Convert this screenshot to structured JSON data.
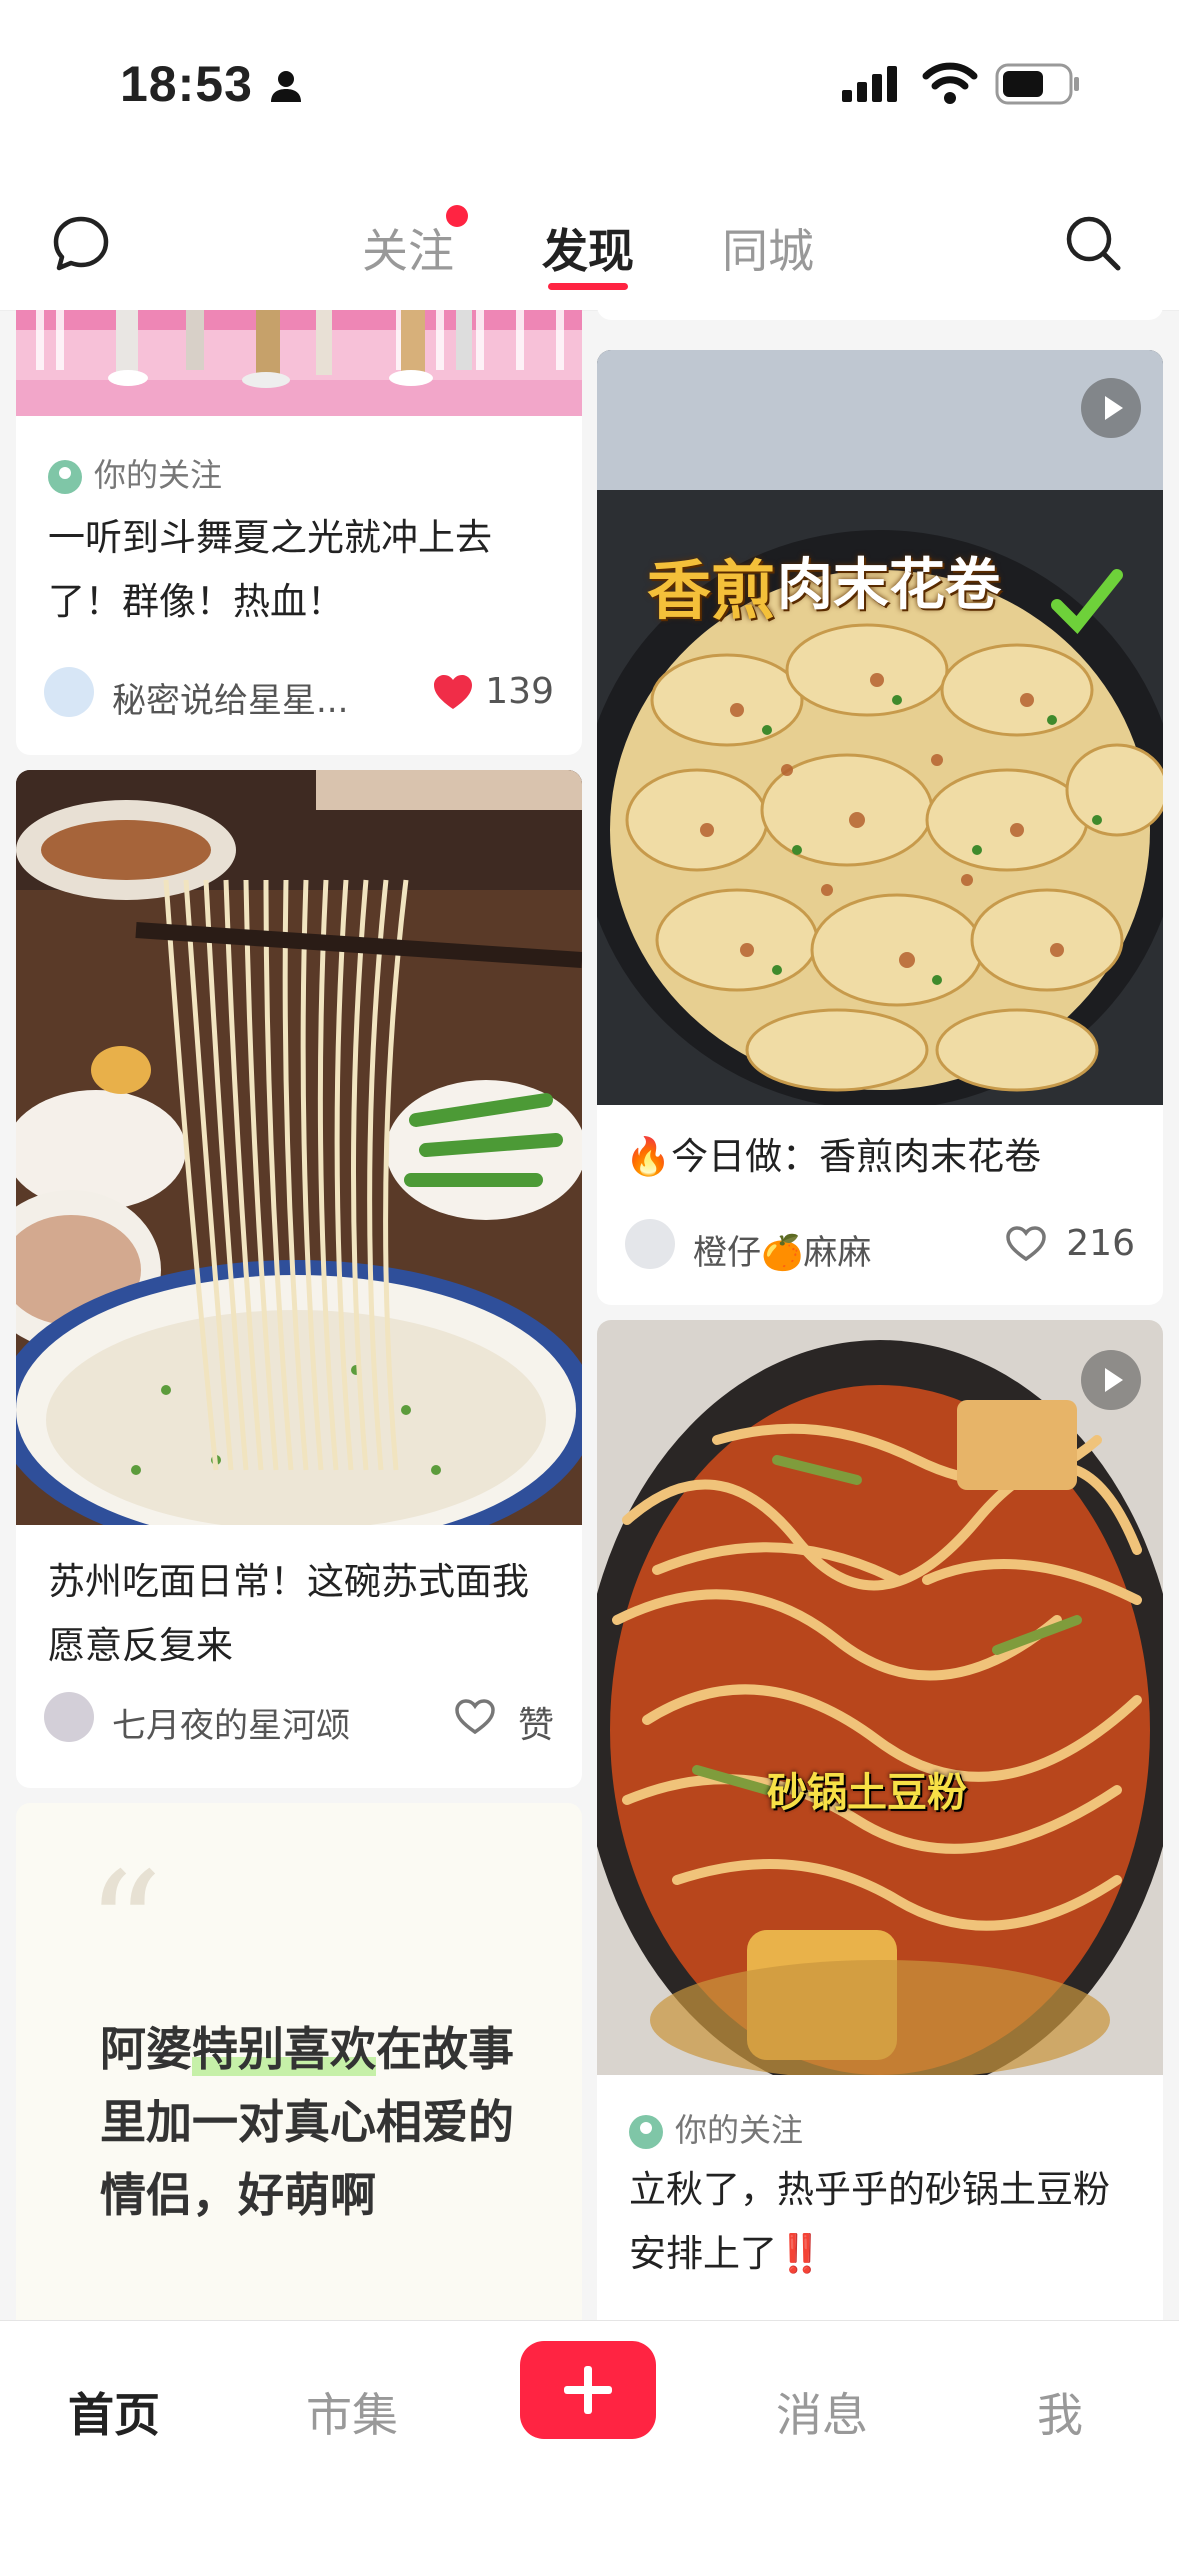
{
  "status_bar": {
    "time": "18:53"
  },
  "header": {
    "tabs": [
      {
        "label": "关注"
      },
      {
        "label": "发现"
      },
      {
        "label": "同城"
      }
    ],
    "active_tab": "发现"
  },
  "feed": {
    "left": [
      {
        "follow_tag": "你的关注",
        "title": "一听到斗舞夏之光就冲上去了！群像！热血！",
        "author": "秘密说给星星...",
        "likes": "139",
        "liked": true
      },
      {
        "title": "苏州吃面日常！这碗苏式面我愿意反复来",
        "author": "七月夜的星河颂",
        "likes": "赞",
        "liked": false
      },
      {
        "quote_before": "阿婆",
        "quote_highlight": "特别喜欢",
        "quote_after": "在故事里加一对真心相爱的情侣，好萌啊"
      }
    ],
    "right": [
      {
        "image_caption_a": "香煎",
        "image_caption_b": "肉末花卷",
        "title": "🔥今日做：香煎肉末花卷",
        "author": "橙仔🍊麻麻",
        "likes": "216",
        "liked": false
      },
      {
        "image_caption": "砂锅土豆粉",
        "follow_tag": "你的关注",
        "title": "立秋了，热乎乎的砂锅土豆粉安排上了‼️"
      }
    ]
  },
  "bottom_nav": {
    "items": [
      {
        "label": "首页"
      },
      {
        "label": "市集"
      },
      {
        "label": "消息"
      },
      {
        "label": "我"
      }
    ],
    "active": "首页"
  },
  "colors": {
    "accent": "#ff2442",
    "follow_badge": "#7fc6a7"
  }
}
